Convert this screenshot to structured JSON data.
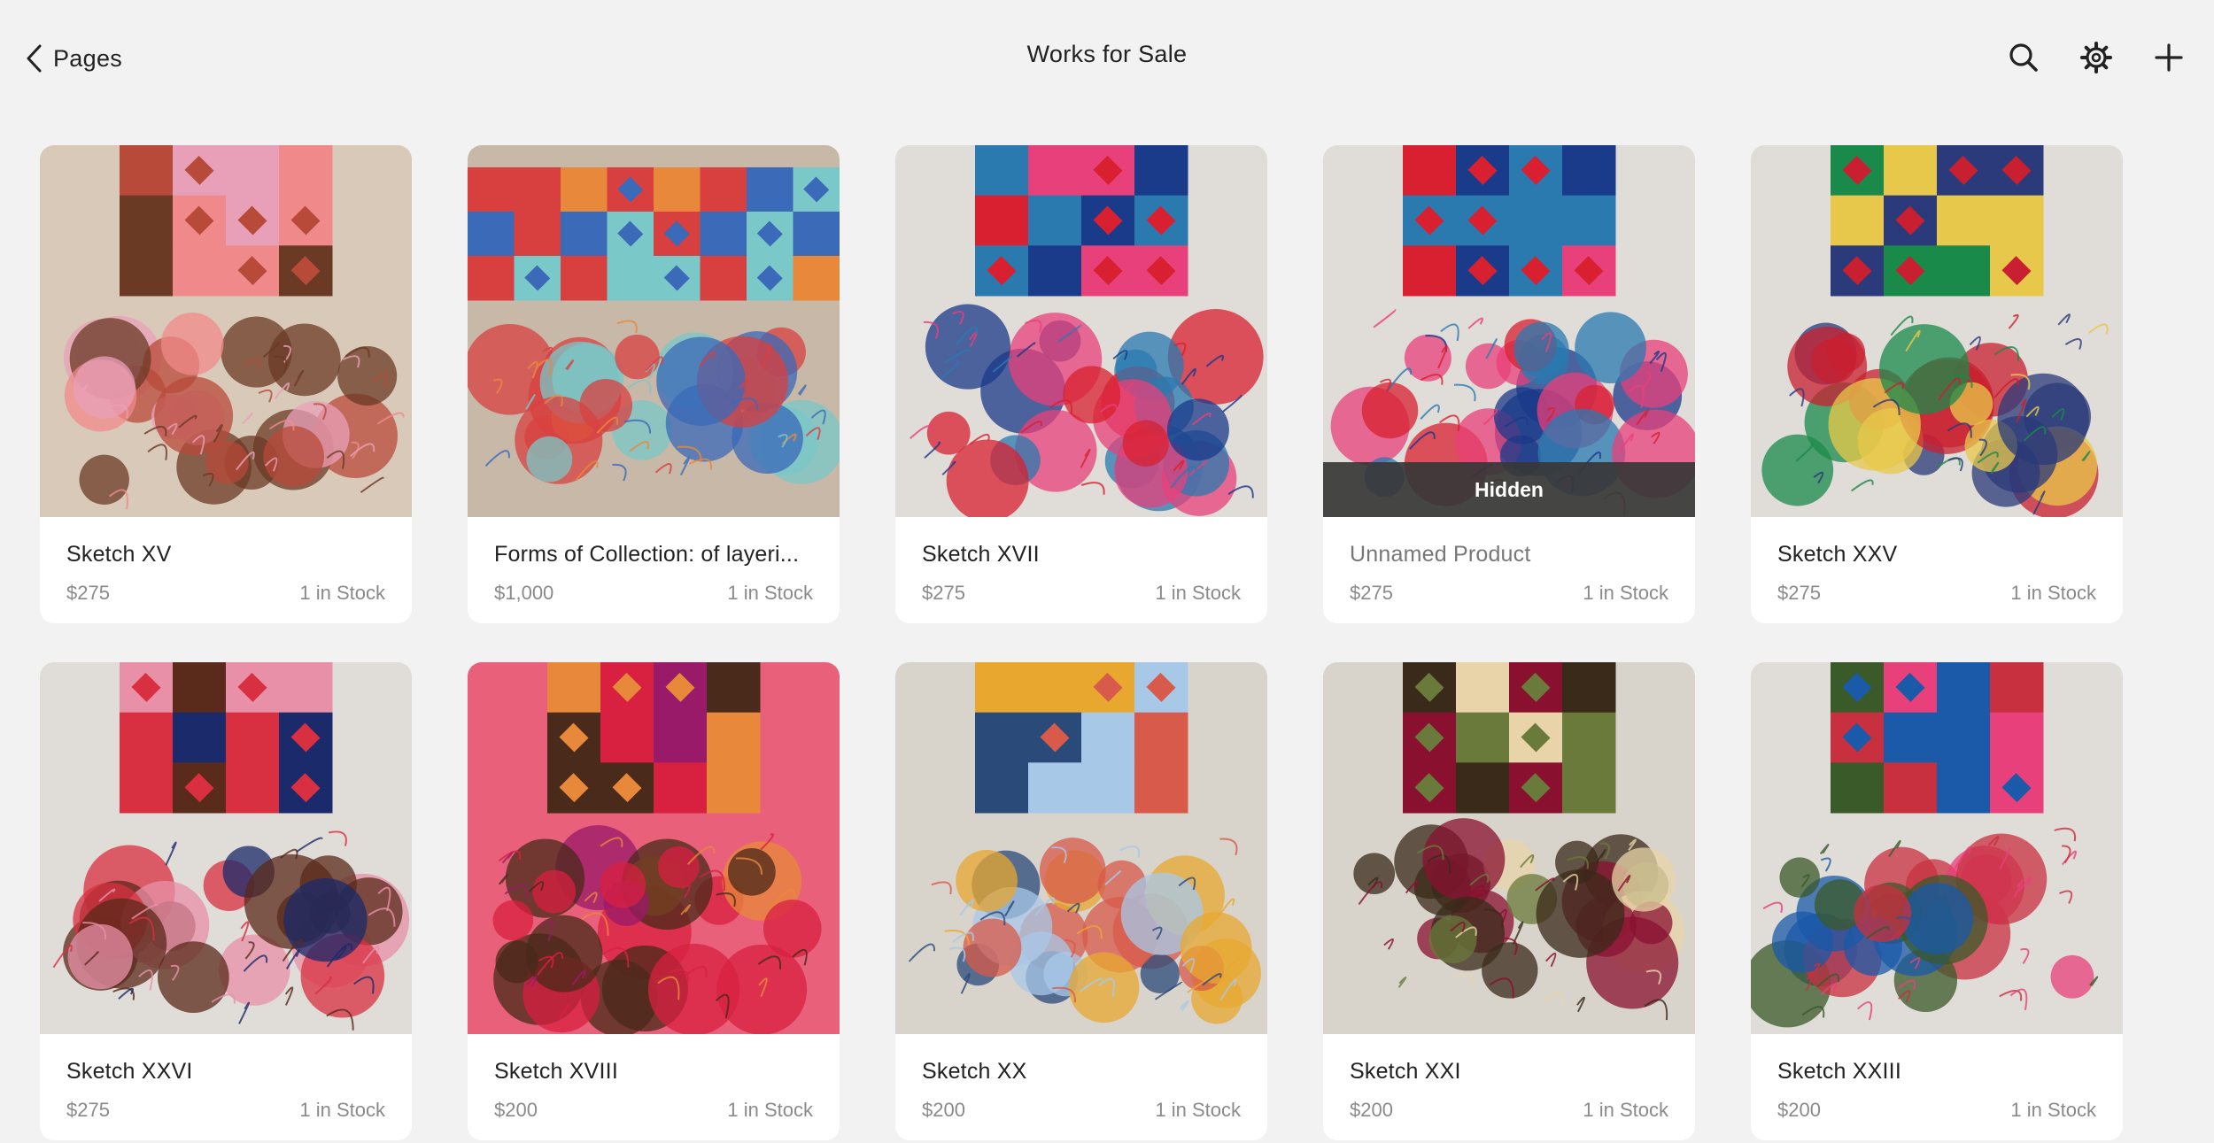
{
  "header": {
    "back_label": "Pages",
    "title": "Works for Sale",
    "icons": [
      "chevron-left-icon",
      "search-icon",
      "gear-icon",
      "plus-icon"
    ]
  },
  "products": [
    {
      "title": "Sketch XV",
      "price": "$275",
      "stock": "1 in Stock",
      "hidden": false,
      "colors": [
        "#f08a8a",
        "#b84a3a",
        "#e8a0b8",
        "#6a3a24",
        "#d9c9b8"
      ]
    },
    {
      "title": "Forms of Collection: of layeri...",
      "price": "$1,000",
      "stock": "1 in Stock",
      "hidden": false,
      "colors": [
        "#d84040",
        "#3a6ab8",
        "#e8883a",
        "#7ac8c8",
        "#c8b8a8"
      ]
    },
    {
      "title": "Sketch XVII",
      "price": "$275",
      "stock": "1 in Stock",
      "hidden": false,
      "colors": [
        "#1a3a8a",
        "#d82030",
        "#e8407a",
        "#2a7ab0",
        "#e0dcd8"
      ]
    },
    {
      "title": "Unnamed Product",
      "price": "$275",
      "stock": "1 in Stock",
      "hidden": true,
      "hidden_label": "Hidden",
      "colors": [
        "#1a3a8a",
        "#d82030",
        "#e8407a",
        "#2a7ab0",
        "#e0dcd8"
      ]
    },
    {
      "title": "Sketch XXV",
      "price": "$275",
      "stock": "1 in Stock",
      "hidden": false,
      "colors": [
        "#1a8a4a",
        "#c82030",
        "#e8c84a",
        "#2a3a7a",
        "#e0dcd8"
      ]
    },
    {
      "title": "Sketch XXVI",
      "price": "$275",
      "stock": "1 in Stock",
      "hidden": false,
      "colors": [
        "#5a2a1a",
        "#d83040",
        "#1a2a6a",
        "#e890a8",
        "#e0dcd8"
      ]
    },
    {
      "title": "Sketch XVIII",
      "price": "$200",
      "stock": "1 in Stock",
      "hidden": false,
      "colors": [
        "#9a1a6a",
        "#e8883a",
        "#d82040",
        "#4a2a1a",
        "#e8607a"
      ]
    },
    {
      "title": "Sketch XX",
      "price": "$200",
      "stock": "1 in Stock",
      "hidden": false,
      "colors": [
        "#e8a830",
        "#d85a4a",
        "#2a4a7a",
        "#a8c8e8",
        "#d8d4cc"
      ]
    },
    {
      "title": "Sketch XXI",
      "price": "$200",
      "stock": "1 in Stock",
      "hidden": false,
      "colors": [
        "#8a1030",
        "#6a7a3a",
        "#e8d4a8",
        "#3a2a1a",
        "#d8d4cc"
      ]
    },
    {
      "title": "Sketch XXIII",
      "price": "$200",
      "stock": "1 in Stock",
      "hidden": false,
      "colors": [
        "#e8407a",
        "#1a5aa8",
        "#3a5a2a",
        "#c83040",
        "#e0dcd8"
      ]
    }
  ]
}
